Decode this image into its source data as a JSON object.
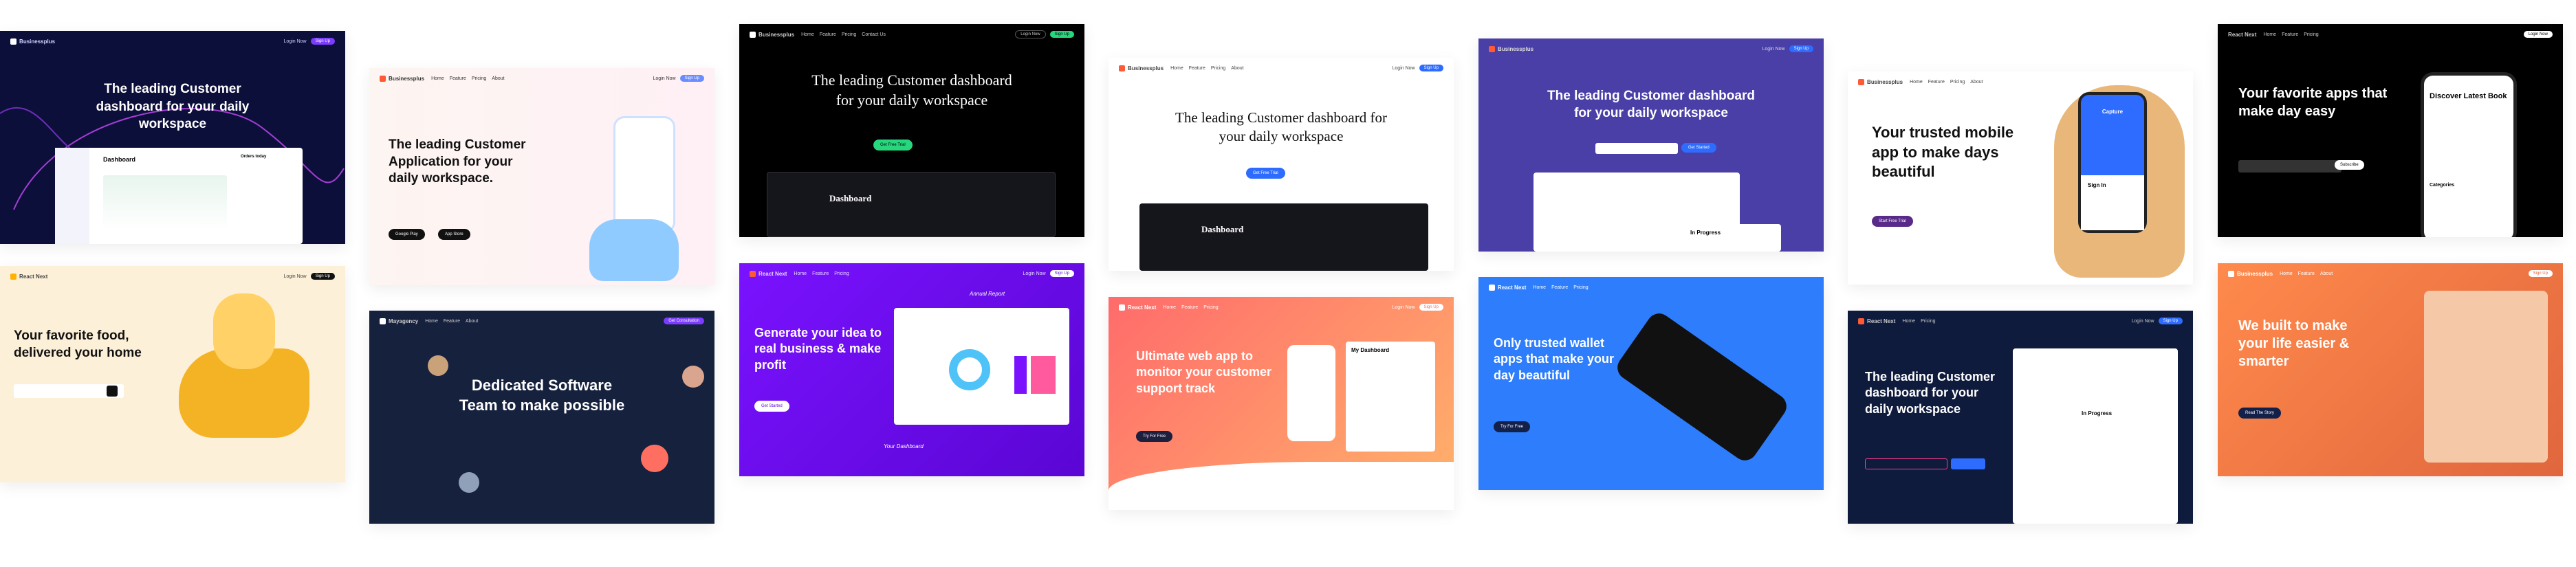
{
  "nav": {
    "c1_logo": "Businessplus",
    "c2_logo": "Businessplus",
    "c3_logo": "Businessplus",
    "c4_logo": "Businessplus",
    "c5_logo": "Businessplus",
    "c6_logo": "Businessplus",
    "c7_logo": "React Next",
    "c8_logo": "React Next",
    "c9_logo": "Mayagency",
    "c10_logo": "React Next",
    "c11_logo": "React Next",
    "c12_logo": "React Next",
    "c13_logo": "React Next",
    "c14_logo": "Businessplus",
    "links": [
      "Home",
      "Feature",
      "Pricing",
      "About",
      "Contact Us"
    ],
    "login": "Login Now",
    "signup": "Sign Up"
  },
  "c1": {
    "title": "The leading Customer dashboard for your daily workspace",
    "dash": "Dashboard",
    "orders": "Orders today"
  },
  "c2": {
    "title": "The leading Customer Application for your daily workspace.",
    "gp": "Google Play",
    "as": "App Store"
  },
  "c3": {
    "title": "The leading Customer dashboard for your daily workspace",
    "btn": "Get Free Trial",
    "dash": "Dashboard"
  },
  "c4": {
    "title": "The leading Customer dashboard for your daily workspace",
    "btn": "Get Free Trial",
    "dash": "Dashboard"
  },
  "c5": {
    "title": "The leading Customer dashboard for your daily workspace",
    "btn": "Get Started",
    "progress": "In Progress"
  },
  "c6": {
    "title": "Your trusted mobile app to make days beautiful",
    "btn": "Start Free Trial",
    "cap": "Capture",
    "signin": "Sign In"
  },
  "c7": {
    "title": "Your favorite apps that make day easy",
    "book": "Discover Latest Book",
    "cat": "Categories",
    "cta": "Subscribe"
  },
  "c8": {
    "title": "Your favorite food, delivered your home"
  },
  "c9": {
    "title": "Dedicated Software Team to make possible",
    "btn": "Get Consultation"
  },
  "c10": {
    "title": "Generate your idea to real business & make profit",
    "btn": "Get Started",
    "anno1": "Annual Report",
    "anno2": "Your Dashboard"
  },
  "c11": {
    "title": "Ultimate web app to monitor your customer support track",
    "btn": "Try For Free",
    "dash": "My Dashboard"
  },
  "c12": {
    "title": "Only trusted wallet apps that make your day beautiful",
    "btn": "Try For Free"
  },
  "c13": {
    "title": "The leading Customer dashboard for your daily workspace",
    "progress": "In Progress"
  },
  "c14": {
    "title": "We built to make your life easier & smarter",
    "btn": "Read The Story"
  }
}
